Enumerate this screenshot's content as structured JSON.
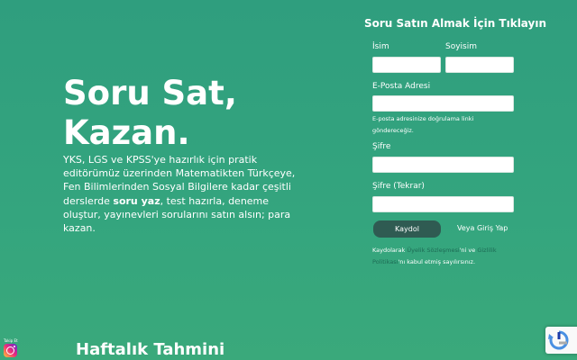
{
  "hero": {
    "title_line1": "Soru Sat,",
    "title_line2": "Kazan.",
    "desc_pre": "YKS, LGS ve KPSS'ye hazırlık için pratik editörümüz üzerinden Matematikten Türkçeye, Fen Bilimlerinden Sosyal Bilgilere kadar çeşitli derslerde ",
    "desc_bold": "soru yaz",
    "desc_post": ", test hazırla, deneme oluştur, yayınevleri sorularını satın alsın; para kazan."
  },
  "form": {
    "title": "Soru Satın Almak İçin Tıklayın",
    "first_name_label": "İsim",
    "last_name_label": "Soyisim",
    "email_label": "E-Posta Adresi",
    "email_hint": "E-posta adresinize doğrulama linki göndereceğiz.",
    "password_label": "Şifre",
    "password_repeat_label": "Şifre (Tekrar)",
    "register_button": "Kaydol",
    "login_link": "Veya Giriş Yap",
    "terms_pre": "Kaydolarak ",
    "terms_link1": "Üyelik Sözleşmesi",
    "terms_mid": "'ni ve ",
    "terms_link2": "Gizlilik Politikası",
    "terms_post": "'nı kabul etmiş sayılırsınız."
  },
  "footer": {
    "weekly_title": "Haftalık Tahmini",
    "follow_label": "Takip Et"
  },
  "icons": {
    "instagram": "instagram-icon",
    "recaptcha": "recaptcha-icon"
  },
  "colors": {
    "background": "#34a57e",
    "button": "#2f5b52",
    "link": "#1e6b55"
  }
}
